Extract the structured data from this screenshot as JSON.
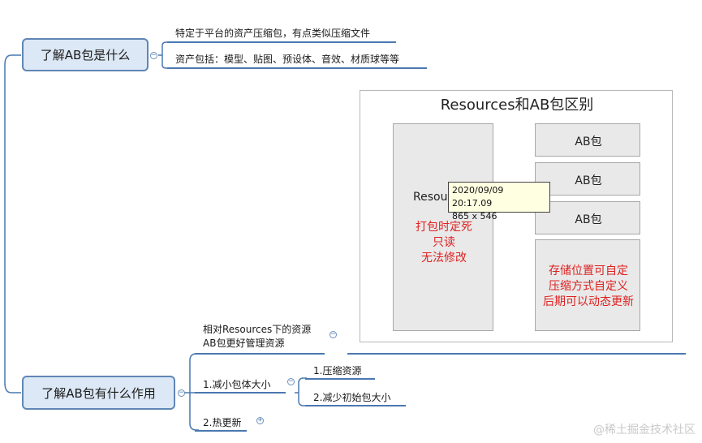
{
  "topics": {
    "what_is_ab": "了解AB包是什么",
    "ab_usage": "了解AB包有什么作用"
  },
  "what_is_ab_children": [
    "特定于平台的资产压缩包，有点类似压缩文件",
    "资产包括：模型、贴图、预设体、音效、材质球等等"
  ],
  "usage_children": {
    "manage_line1": "相对Resources下的资源",
    "manage_line2": "AB包更好管理资源",
    "reduce_size": "1.减小包体大小",
    "compress": "1.压缩资源",
    "reduce_initial": "2.减少初始包大小",
    "hot_update": "2.热更新"
  },
  "toggles": {
    "collapse": "−",
    "expand": "+"
  },
  "comparison": {
    "title": "Resources和AB包区别",
    "resources_label": "Resou",
    "resources_notes": [
      "打包时定死",
      "只读",
      "无法修改"
    ],
    "ab_items": [
      "AB包",
      "AB包",
      "AB包"
    ],
    "ab_notes": [
      "存储位置可自定",
      "压缩方式自定义",
      "后期可以动态更新"
    ]
  },
  "tooltip": {
    "datetime": "2020/09/09 20:17.09",
    "size": "865 x 546"
  },
  "watermark": "@稀土掘金技术社区",
  "colors": {
    "topic_fill": "#dce8f5",
    "topic_border": "#5f87b5",
    "branch_line": "#4a78b0",
    "note_red": "#e02020"
  }
}
